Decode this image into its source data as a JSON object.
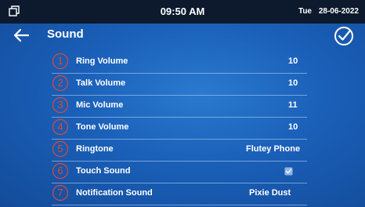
{
  "status_bar": {
    "time": "09:50 AM",
    "day": "Tue",
    "date": "28-06-2022",
    "left_icon": "window-icon"
  },
  "header": {
    "back_icon": "back-arrow-icon",
    "title": "Sound",
    "confirm_icon": "check-circle-icon"
  },
  "settings": [
    {
      "number": "1",
      "label": "Ring Volume",
      "value": "10",
      "type": "value"
    },
    {
      "number": "2",
      "label": "Talk Volume",
      "value": "10",
      "type": "value"
    },
    {
      "number": "3",
      "label": "Mic Volume",
      "value": "11",
      "type": "value"
    },
    {
      "number": "4",
      "label": "Tone Volume",
      "value": "10",
      "type": "value"
    },
    {
      "number": "5",
      "label": "Ringtone",
      "value": "Flutey Phone",
      "type": "value"
    },
    {
      "number": "6",
      "label": "Touch Sound",
      "value": "",
      "checked": true,
      "type": "checkbox"
    },
    {
      "number": "7",
      "label": "Notification Sound",
      "value": "Pixie Dust",
      "type": "value"
    }
  ],
  "colors": {
    "background": "#1a5fb8",
    "status_bar": "#0d1a2e",
    "annotation": "#d94a3a",
    "checkbox": "#8fb5e6"
  }
}
